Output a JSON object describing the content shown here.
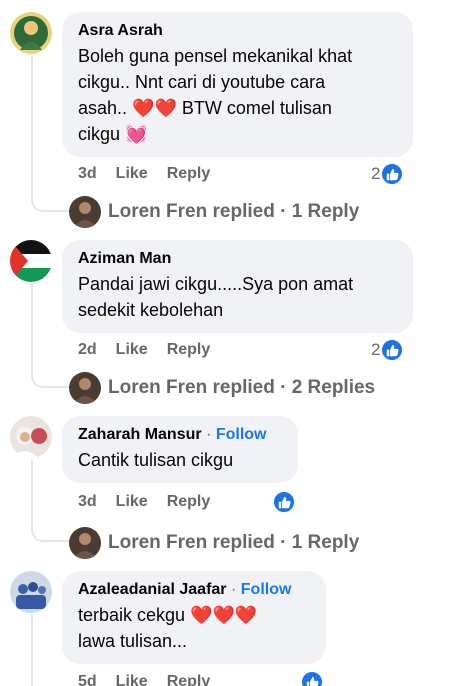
{
  "comments": [
    {
      "author": "Asra Asrah",
      "follow": "",
      "lines": [
        "Boleh guna pensel mekanikal khat",
        "cikgu.. Nnt cari di youtube cara",
        "asah.. ❤️❤️ BTW comel tulisan",
        "cikgu 💓"
      ],
      "time": "3d",
      "like": "Like",
      "reply": "Reply",
      "reaction_count": "2",
      "replied_text": "Loren Fren replied · 1 Reply"
    },
    {
      "author": "Aziman Man",
      "follow": "",
      "lines": [
        "Pandai jawi cikgu.....Sya pon amat",
        "sedekit kebolehan"
      ],
      "time": "2d",
      "like": "Like",
      "reply": "Reply",
      "reaction_count": "2",
      "replied_text": "Loren Fren replied · 2 Replies"
    },
    {
      "author": "Zaharah Mansur",
      "follow": "Follow",
      "lines": [
        "Cantik tulisan cikgu"
      ],
      "time": "3d",
      "like": "Like",
      "reply": "Reply",
      "reaction_count": "",
      "replied_text": "Loren Fren replied · 1 Reply"
    },
    {
      "author": "Azaleadanial Jaafar",
      "follow": "Follow",
      "lines": [
        "terbaik cekgu ❤️❤️❤️",
        "lawa tulisan..."
      ],
      "time": "5d",
      "like": "Like",
      "reply": "Reply",
      "reaction_count": "",
      "replied_text": ""
    }
  ],
  "separator": "·",
  "colors": {
    "accent": "#1877f2",
    "bubble": "#f0f2f5",
    "meta": "#65676b"
  },
  "icons": {
    "like": "thumbs-up-icon"
  }
}
